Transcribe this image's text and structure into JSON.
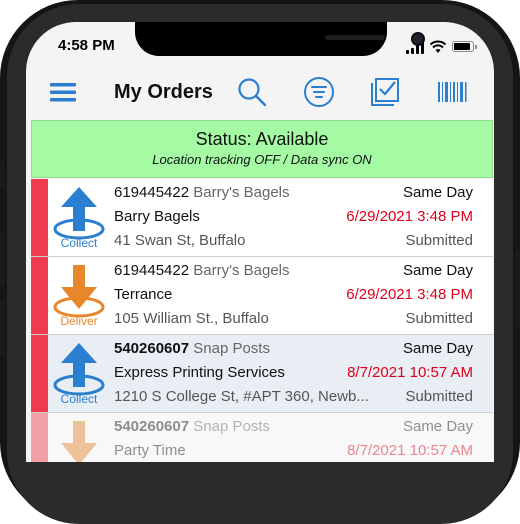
{
  "status_bar": {
    "time": "4:58 PM"
  },
  "toolbar": {
    "title": "My Orders"
  },
  "status_panel": {
    "title": "Status: Available",
    "subtitle": "Location tracking OFF / Data sync ON"
  },
  "colors": {
    "accent": "#2a7fd1",
    "collect": "#2a7fd1",
    "deliver": "#e8862a",
    "strip": "#ee3b4d",
    "status_bg": "#a4fba4",
    "due_date": "#e0001c"
  },
  "orders": [
    {
      "id": "619445422",
      "company": "Barry's Bagels",
      "contact": "Barry Bagels",
      "address": "41 Swan St, Buffalo",
      "speed": "Same Day",
      "due": "6/29/2021 3:48 PM",
      "status": "Submitted",
      "action": "Collect",
      "icon": "collect-arrow-up-icon"
    },
    {
      "id": "619445422",
      "company": "Barry's Bagels",
      "contact": "Terrance",
      "address": "105 William St., Buffalo",
      "speed": "Same Day",
      "due": "6/29/2021 3:48 PM",
      "status": "Submitted",
      "action": "Deliver",
      "icon": "deliver-arrow-down-icon"
    },
    {
      "id": "540260607",
      "company": "Snap Posts",
      "contact": "Express Printing Services",
      "address": "1210 S College St, #APT 360, Newb...",
      "speed": "Same Day",
      "due": "8/7/2021 10:57 AM",
      "status": "Submitted",
      "action": "Collect",
      "icon": "collect-arrow-up-icon"
    },
    {
      "id": "540260607",
      "company": "Snap Posts",
      "contact": "Party Time",
      "address": "",
      "speed": "Same Day",
      "due": "8/7/2021 10:57 AM",
      "status": "",
      "action": "",
      "icon": "deliver-arrow-down-icon"
    }
  ]
}
